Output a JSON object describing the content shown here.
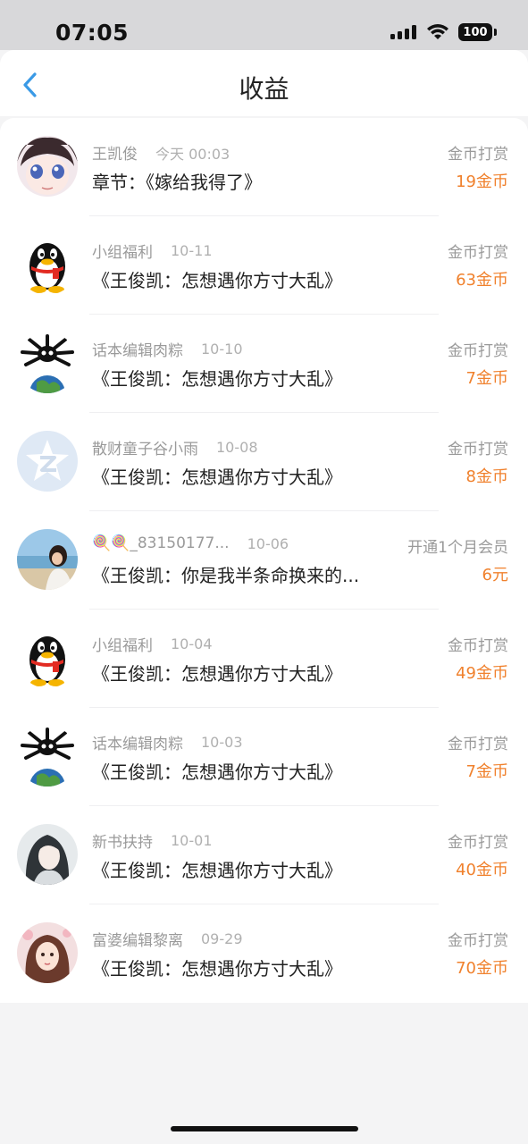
{
  "status_bar": {
    "time": "07:05",
    "battery": "100"
  },
  "header": {
    "title": "收益"
  },
  "items": [
    {
      "name": "王凯俊",
      "date": "今天 00:03",
      "title": "章节：《嫁给我得了》",
      "type": "金币打赏",
      "amount": "19金币",
      "avatar_icon": "anime-girl-avatar"
    },
    {
      "name": "小组福利",
      "date": "10-11",
      "title": "《王俊凯：怎想遇你方寸大乱》",
      "type": "金币打赏",
      "amount": "63金币",
      "avatar_icon": "qq-penguin-avatar"
    },
    {
      "name": "话本编辑肉粽",
      "date": "10-10",
      "title": "《王俊凯：怎想遇你方寸大乱》",
      "type": "金币打赏",
      "amount": "7金币",
      "avatar_icon": "skull-earth-avatar"
    },
    {
      "name": "散财童子谷小雨",
      "date": "10-08",
      "title": "《王俊凯：怎想遇你方寸大乱》",
      "type": "金币打赏",
      "amount": "8金币",
      "avatar_icon": "qzone-star-avatar"
    },
    {
      "name": "🍭🍭_83150177...",
      "date": "10-06",
      "title": "《王俊凯：你是我半条命换来的...",
      "type": "开通1个月会员",
      "amount": "6元",
      "avatar_icon": "beach-photo-avatar"
    },
    {
      "name": "小组福利",
      "date": "10-04",
      "title": "《王俊凯：怎想遇你方寸大乱》",
      "type": "金币打赏",
      "amount": "49金币",
      "avatar_icon": "qq-penguin-avatar"
    },
    {
      "name": "话本编辑肉粽",
      "date": "10-03",
      "title": "《王俊凯：怎想遇你方寸大乱》",
      "type": "金币打赏",
      "amount": "7金币",
      "avatar_icon": "skull-earth-avatar"
    },
    {
      "name": "新书扶持",
      "date": "10-01",
      "title": "《王俊凯：怎想遇你方寸大乱》",
      "type": "金币打赏",
      "amount": "40金币",
      "avatar_icon": "ancient-portrait-avatar"
    },
    {
      "name": "富婆编辑黎离",
      "date": "09-29",
      "title": "《王俊凯：怎想遇你方寸大乱》",
      "type": "金币打赏",
      "amount": "70金币",
      "avatar_icon": "painted-girl-avatar"
    }
  ],
  "colors": {
    "accent_blue": "#3a9ae6",
    "amount_orange": "#f0812d"
  }
}
